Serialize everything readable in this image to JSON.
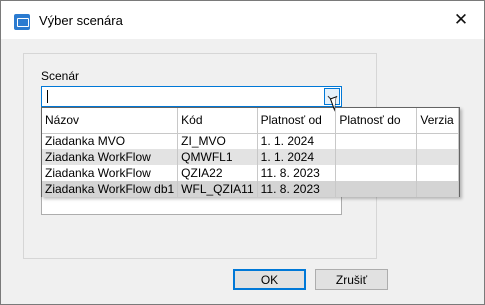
{
  "window": {
    "title": "Výber scenára"
  },
  "form": {
    "scenario_label": "Scenár",
    "combo_value": ""
  },
  "dropdown": {
    "columns": [
      "Názov",
      "Kód",
      "Platnosť od",
      "Platnosť do",
      "Verzia"
    ],
    "rows": [
      [
        "Ziadanka MVO",
        "ZI_MVO",
        "1. 1. 2024",
        "",
        ""
      ],
      [
        "Ziadanka WorkFlow",
        "QMWFL1",
        "1. 1. 2024",
        "",
        ""
      ],
      [
        "Ziadanka WorkFlow",
        "QZIA22",
        "11. 8. 2023",
        "",
        ""
      ],
      [
        "Ziadanka WorkFlow db1",
        "WFL_QZIA11",
        "11. 8. 2023",
        "",
        ""
      ]
    ]
  },
  "buttons": {
    "ok": "OK",
    "cancel": "Zrušiť"
  },
  "colors": {
    "accent": "#0078d7",
    "app_icon": "#2b7bd0"
  },
  "icons": {
    "app": "window-app-icon",
    "close": "close-icon",
    "dropdown": "chevron-down-icon"
  }
}
